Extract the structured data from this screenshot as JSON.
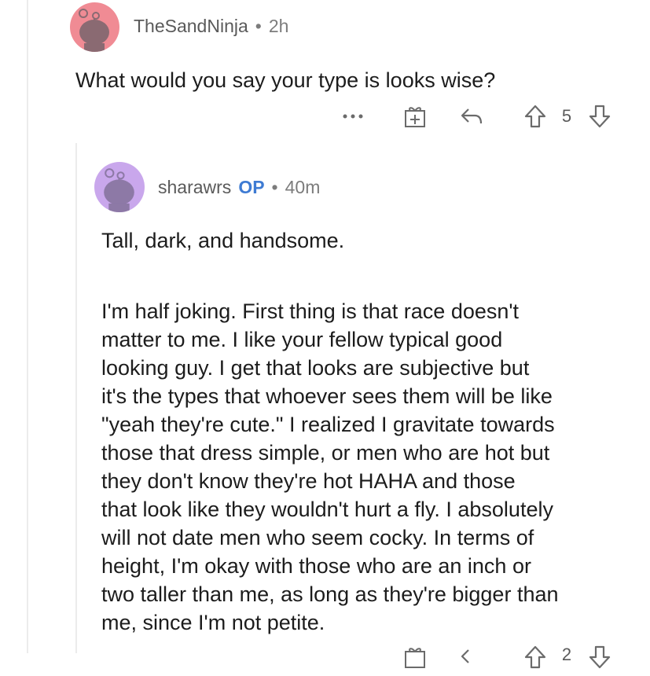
{
  "comment1": {
    "username": "TheSandNinja",
    "separator": "•",
    "time": "2h",
    "text": "What would you say your type is looks wise?",
    "vote_count": "5",
    "more_label": "•••",
    "avatar_color": "#f08b94"
  },
  "comment2": {
    "username": "sharawrs",
    "op_badge": "OP",
    "separator": "•",
    "time": "40m",
    "paragraph1": "Tall, dark, and handsome.",
    "paragraph2_lines": [
      "I'm half joking. First thing is that race doesn't",
      "matter to me. I like your fellow typical good",
      "looking guy. I get that looks are subjective but",
      "it's the types that whoever sees them will be like",
      "\"yeah they're cute.\" I realized I gravitate towards",
      "those that dress simple, or men who are hot but",
      "they don't know they're hot HAHA and those",
      "that look like they wouldn't hurt a fly. I absolutely",
      "will not date men who seem cocky. In terms of",
      "height, I'm okay with those who are an inch or",
      "two taller than me, as long as they're bigger than",
      "me, since I'm not petite."
    ],
    "vote_count": "2",
    "avatar_color": "#c9a7ec"
  },
  "colors": {
    "op_badge": "#3e7bd3",
    "meta_text": "#7c7c7c",
    "icon_stroke": "#6b6b6b"
  }
}
